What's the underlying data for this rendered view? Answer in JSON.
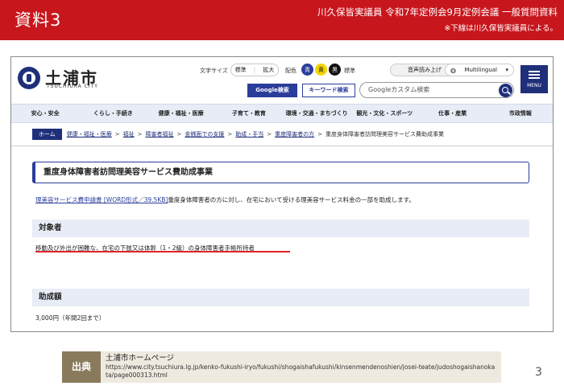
{
  "banner": {
    "label": "資料3",
    "line1": "川久保皆実議員 令和7年定例会9月定例会議 一般質問資料",
    "line2": "※下線は川久保皆実議員による。"
  },
  "site": {
    "name": "土浦市",
    "sub": "TSUCHIURA CITY",
    "font_size_label": "文字サイズ",
    "size_standard": "標準",
    "size_enlarge": "拡大",
    "color_label": "配色",
    "color_blue": "青",
    "color_yellow": "黄",
    "color_black": "黒",
    "color_standard": "標準",
    "voice": "音声読み上げ",
    "multilingual": "Multilingual",
    "menu": "MENU",
    "google_search": "Google検索",
    "keyword_search": "キーワード検索",
    "search_placeholder": "Googleカスタム検索"
  },
  "nav": [
    "安心・安全",
    "くらし・手続き",
    "健康・福祉・医療",
    "子育て・教育",
    "環境・交通・まちづくり",
    "観光・文化・スポーツ",
    "仕事・産業",
    "市政情報"
  ],
  "breadcrumb": {
    "home": "ホーム",
    "links": [
      "健康・福祉・医療",
      "福祉",
      "障害者福祉",
      "金銭面での支援",
      "助成・手当",
      "重度障害者の方"
    ],
    "current": "重度身体障害者訪問理美容サービス費助成事業"
  },
  "page": {
    "title": "重度身体障害者訪問理美容サービス費助成事業",
    "intro_link": "理美容サービス費申請書 [WORD形式／39.5KB]",
    "intro_text": "重度身体障害者の方に対し、在宅において受ける理美容サービス料金の一部を助成します。",
    "sec1_heading": "対象者",
    "sec1_text": "移動及び外出が困難な、在宅の下肢又は体幹（1・2級）の身体障害者手帳所持者",
    "sec2_heading": "助成額",
    "sec2_text": "3,000円（年間2回まで）"
  },
  "source": {
    "tag": "出典",
    "title": "土浦市ホームページ",
    "url": "https://www.city.tsuchiura.lg.jp/kenko-fukushi-iryo/fukushi/shogaishafukushi/kinsenmendenoshien/josei-teate/judoshogaishanokata/page000313.html"
  },
  "page_number": "3",
  "colors": {
    "banner": "#c8161d",
    "accent": "#1f2f7a",
    "underline": "#e0222b"
  }
}
